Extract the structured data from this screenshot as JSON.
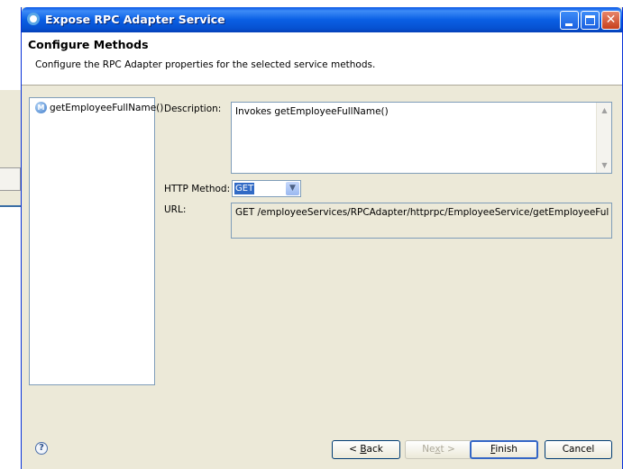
{
  "window": {
    "title": "Expose RPC Adapter Service"
  },
  "header": {
    "title": "Configure Methods",
    "description": "Configure the RPC Adapter properties for the selected service methods."
  },
  "methods": [
    {
      "icon": "M",
      "label": "getEmployeeFullName()"
    }
  ],
  "form": {
    "description_label": "Description:",
    "description_value": "Invokes getEmployeeFullName()",
    "http_method_label": "HTTP Method:",
    "http_method_value": "GET",
    "url_label": "URL:",
    "url_value": "GET /employeeServices/RPCAdapter/httprpc/EmployeeService/getEmployeeFullName"
  },
  "buttons": {
    "help": "?",
    "back_prefix": "< ",
    "back_mnemonic": "B",
    "back_rest": "ack",
    "next_prefix": "Ne",
    "next_mnemonic": "x",
    "next_rest": "t >",
    "finish_mnemonic": "F",
    "finish_rest": "inish",
    "cancel": "Cancel"
  }
}
